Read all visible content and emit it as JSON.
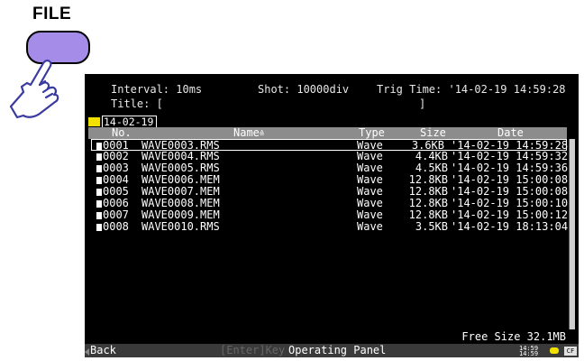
{
  "button": {
    "label": "FILE"
  },
  "header": {
    "interval": "Interval: 10ms",
    "shot": "Shot: 10000div",
    "trig_time": "Trig Time: '14-02-19 14:59:28",
    "title_label": "Title: [",
    "title_close": "]"
  },
  "folder": {
    "name": "14-02-19"
  },
  "columns": {
    "no": "No.",
    "name": "Name",
    "type": "Type",
    "size": "Size",
    "date": "Date"
  },
  "files": [
    {
      "no": "0001",
      "name": "WAVE0003.RMS",
      "type": "Wave",
      "size": "3.6KB",
      "date": "'14-02-19 14:59:28"
    },
    {
      "no": "0002",
      "name": "WAVE0004.RMS",
      "type": "Wave",
      "size": "4.4KB",
      "date": "'14-02-19 14:59:32"
    },
    {
      "no": "0003",
      "name": "WAVE0005.RMS",
      "type": "Wave",
      "size": "4.5KB",
      "date": "'14-02-19 14:59:36"
    },
    {
      "no": "0004",
      "name": "WAVE0006.MEM",
      "type": "Wave",
      "size": "12.8KB",
      "date": "'14-02-19 15:00:08"
    },
    {
      "no": "0005",
      "name": "WAVE0007.MEM",
      "type": "Wave",
      "size": "12.8KB",
      "date": "'14-02-19 15:00:08"
    },
    {
      "no": "0006",
      "name": "WAVE0008.MEM",
      "type": "Wave",
      "size": "12.8KB",
      "date": "'14-02-19 15:00:10"
    },
    {
      "no": "0007",
      "name": "WAVE0009.MEM",
      "type": "Wave",
      "size": "12.8KB",
      "date": "'14-02-19 15:00:12"
    },
    {
      "no": "0008",
      "name": "WAVE0010.RMS",
      "type": "Wave",
      "size": "3.5KB",
      "date": "'14-02-19 18:13:04"
    }
  ],
  "footer": {
    "free_size": "Free Size 32.1MB",
    "back": "Back",
    "enter_key": "[Enter]Key",
    "operating_panel": "Operating Panel",
    "card_label": "CF"
  },
  "colors": {
    "button": "#a48ce8",
    "folder": "#f2e000",
    "header_bar": "#8c8c8c"
  }
}
